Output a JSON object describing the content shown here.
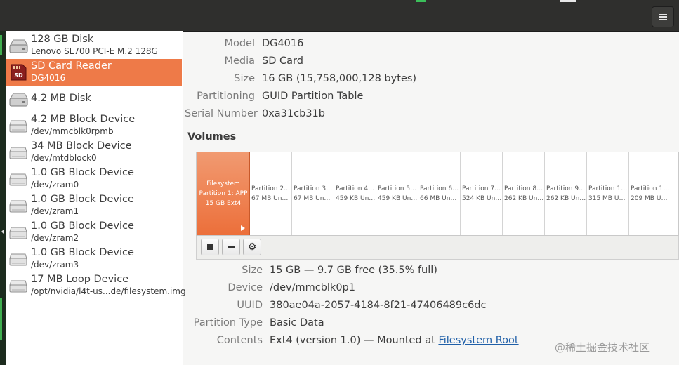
{
  "sidebar": {
    "devices": [
      {
        "title": "128 GB Disk",
        "subtitle": "Lenovo SL700 PCI-E M.2 128G",
        "icon": "disk-icon",
        "selected": false
      },
      {
        "title": "SD Card Reader",
        "subtitle": "DG4016",
        "icon": "sd-card-icon",
        "selected": true
      },
      {
        "title": "4.2 MB Disk",
        "subtitle": "",
        "icon": "disk-icon",
        "selected": false
      },
      {
        "title": "4.2 MB Block Device",
        "subtitle": "/dev/mmcblk0rpmb",
        "icon": "drive-icon",
        "selected": false
      },
      {
        "title": "34 MB Block Device",
        "subtitle": "/dev/mtdblock0",
        "icon": "drive-icon",
        "selected": false
      },
      {
        "title": "1.0 GB Block Device",
        "subtitle": "/dev/zram0",
        "icon": "drive-icon",
        "selected": false
      },
      {
        "title": "1.0 GB Block Device",
        "subtitle": "/dev/zram1",
        "icon": "drive-icon",
        "selected": false
      },
      {
        "title": "1.0 GB Block Device",
        "subtitle": "/dev/zram2",
        "icon": "drive-icon",
        "selected": false
      },
      {
        "title": "1.0 GB Block Device",
        "subtitle": "/dev/zram3",
        "icon": "drive-icon",
        "selected": false
      },
      {
        "title": "17 MB Loop Device",
        "subtitle": "/opt/nvidia/l4t-us...de/filesystem.img",
        "icon": "drive-icon",
        "selected": false
      }
    ]
  },
  "disk_info": {
    "model_label": "Model",
    "model": "DG4016",
    "media_label": "Media",
    "media": "SD Card",
    "size_label": "Size",
    "size": "16 GB (15,758,000,128 bytes)",
    "partitioning_label": "Partitioning",
    "partitioning": "GUID Partition Table",
    "serial_label": "Serial Number",
    "serial": "0xa31cb31b"
  },
  "volumes": {
    "heading": "Volumes",
    "segments": [
      {
        "line1": "Filesystem",
        "line2": "Partition 1: APP",
        "line3": "15 GB Ext4",
        "selected": true
      },
      {
        "line1": "Partition 2: …",
        "line2": "67 MB Unkn…",
        "selected": false
      },
      {
        "line1": "Partition 3: …",
        "line2": "67 MB Unkn…",
        "selected": false
      },
      {
        "line1": "Partition 4: …",
        "line2": "459 KB Unk…",
        "selected": false
      },
      {
        "line1": "Partition 5: …",
        "line2": "459 KB Unk…",
        "selected": false
      },
      {
        "line1": "Partition 6: …",
        "line2": "66 MB Unkn…",
        "selected": false
      },
      {
        "line1": "Partition 7: …",
        "line2": "524 KB Unk…",
        "selected": false
      },
      {
        "line1": "Partition 8: …",
        "line2": "262 KB Unk…",
        "selected": false
      },
      {
        "line1": "Partition 9: …",
        "line2": "262 KB Unk…",
        "selected": false
      },
      {
        "line1": "Partition 1…",
        "line2": "315 MB Unk…",
        "selected": false
      },
      {
        "line1": "Partition 1…",
        "line2": "209 MB Unk…",
        "selected": false
      }
    ],
    "toolbar": [
      "stop-icon",
      "minus-icon",
      "gear-icon"
    ]
  },
  "partition_info": {
    "size_label": "Size",
    "size": "15 GB — 9.7 GB free (35.5% full)",
    "device_label": "Device",
    "device": "/dev/mmcblk0p1",
    "uuid_label": "UUID",
    "uuid": "380ae04a-2057-4184-8f21-47406489c6dc",
    "type_label": "Partition Type",
    "type": "Basic Data",
    "contents_label": "Contents",
    "contents_prefix": "Ext4 (version 1.0) — Mounted at ",
    "contents_link": "Filesystem Root"
  },
  "watermark": "@稀土掘金技术社区",
  "colors": {
    "accent": "#ee7a48",
    "titlebar": "#2f2f2d",
    "link": "#1f5fa8"
  }
}
